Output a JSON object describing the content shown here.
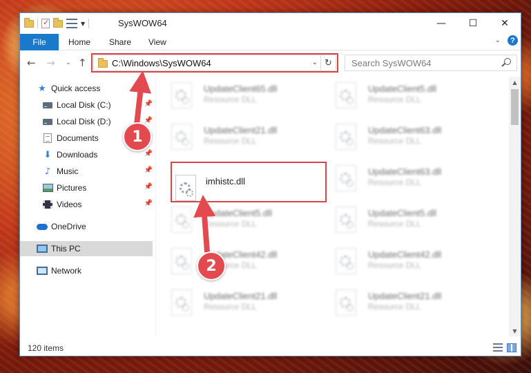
{
  "window": {
    "title": "SysWOW64",
    "controls": {
      "minimize": "—",
      "maximize": "☐",
      "close": "✕"
    }
  },
  "ribbon": {
    "tabs": [
      "File",
      "Home",
      "Share",
      "View"
    ],
    "help": "?"
  },
  "address": {
    "path": "C:\\Windows\\SysWOW64"
  },
  "search": {
    "placeholder": "Search SysWOW64"
  },
  "nav": {
    "quick_access": "Quick access",
    "items": [
      {
        "label": "Local Disk (C:)",
        "icon": "drive-icon",
        "pinned": true
      },
      {
        "label": "Local Disk (D:)",
        "icon": "drive-icon",
        "pinned": true
      },
      {
        "label": "Documents",
        "icon": "documents-icon",
        "pinned": true
      },
      {
        "label": "Downloads",
        "icon": "downloads-icon",
        "pinned": true
      },
      {
        "label": "Music",
        "icon": "music-icon",
        "pinned": true
      },
      {
        "label": "Pictures",
        "icon": "pictures-icon",
        "pinned": true
      },
      {
        "label": "Videos",
        "icon": "videos-icon",
        "pinned": true
      }
    ],
    "onedrive": "OneDrive",
    "this_pc": "This PC",
    "network": "Network"
  },
  "files": {
    "col1": [
      {
        "name": "UpdateClient65.dll",
        "type": "Resource DLL"
      },
      {
        "name": "UpdateClient21.dll",
        "type": "Resource DLL"
      },
      {
        "name": "imhistc.dll",
        "type": ""
      },
      {
        "name": "UpdateClient5.dll",
        "type": "Resource DLL"
      },
      {
        "name": "UpdateClient42.dll",
        "type": "Resource DLL"
      },
      {
        "name": "UpdateClient21.dll",
        "type": "Resource DLL"
      }
    ],
    "col2": [
      {
        "name": "UpdateClient5.dll",
        "type": "Resource DLL"
      },
      {
        "name": "UpdateClient63.dll",
        "type": "Resource DLL"
      },
      {
        "name": "UpdateClient63.dll",
        "type": "Resource DLL"
      },
      {
        "name": "UpdateClient5.dll",
        "type": "Resource DLL"
      },
      {
        "name": "UpdateClient42.dll",
        "type": "Resource DLL"
      },
      {
        "name": "UpdateClient21.dll",
        "type": "Resource DLL"
      }
    ]
  },
  "status": {
    "item_count": "120 items"
  },
  "callouts": [
    "1",
    "2"
  ],
  "colors": {
    "accent": "#1979ca",
    "highlight": "#d9434a",
    "callout": "#e34a4f"
  }
}
